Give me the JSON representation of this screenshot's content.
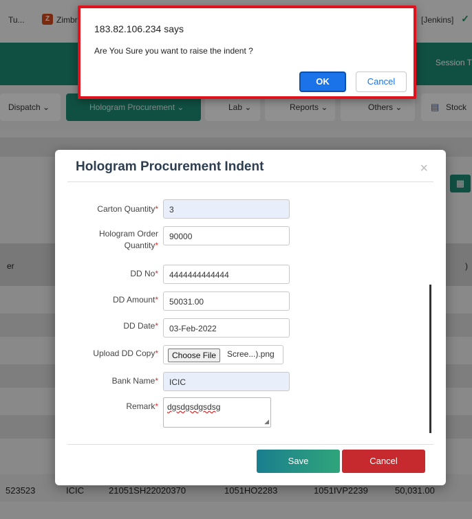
{
  "bookmarks": {
    "items": [
      {
        "label": "Tu..."
      },
      {
        "label": "Zimbr",
        "icon": "zimbra-icon"
      },
      {
        "label": "[Jenkins]"
      }
    ],
    "zimbra_icon_glyph": "Z"
  },
  "header": {
    "session_label": "Session T"
  },
  "menu": {
    "items": [
      {
        "label": "Dispatch ⌄"
      },
      {
        "label": "Hologram Procurement ⌄"
      },
      {
        "label": "Lab ⌄"
      },
      {
        "label": "Reports ⌄"
      },
      {
        "label": "Others ⌄"
      },
      {
        "label": "Stock"
      }
    ],
    "active_index": 1
  },
  "background_table": {
    "header_fragments": [
      "er",
      ")"
    ],
    "row": [
      "523523",
      "ICIC",
      "21051SH22020370",
      "1051HO2283",
      "1051IVP2239",
      "50,031.00"
    ]
  },
  "modal": {
    "title": "Hologram Procurement Indent",
    "close_glyph": "×",
    "fields": {
      "carton_quantity": {
        "label": "Carton Quantity",
        "value": "3"
      },
      "hologram_order_quantity": {
        "label_line1": "Hologram Order",
        "label_line2": "Quantity",
        "value": "90000"
      },
      "dd_no": {
        "label": "DD No",
        "value": "4444444444444"
      },
      "dd_amount": {
        "label": "DD Amount",
        "value": "50031.00"
      },
      "dd_date": {
        "label": "DD Date",
        "value": "03-Feb-2022"
      },
      "upload_dd_copy": {
        "label": "Upload DD Copy",
        "button_label": "Choose File",
        "file_name": "Scree...).png"
      },
      "bank_name": {
        "label": "Bank Name",
        "value": "ICIC"
      },
      "remark": {
        "label": "Remark",
        "value": "dgsdgsdgsdsg"
      }
    },
    "required_marker": "*",
    "save_label": "Save",
    "cancel_label": "Cancel"
  },
  "dialog": {
    "origin": "183.82.106.234 says",
    "message": "Are You Sure you want to raise the indent ?",
    "ok_label": "OK",
    "cancel_label": "Cancel"
  },
  "colors": {
    "brand_teal": "#1d8a73",
    "danger_red": "#c62a2f",
    "highlight_border": "#e0121d",
    "ok_blue": "#1a73e8"
  }
}
